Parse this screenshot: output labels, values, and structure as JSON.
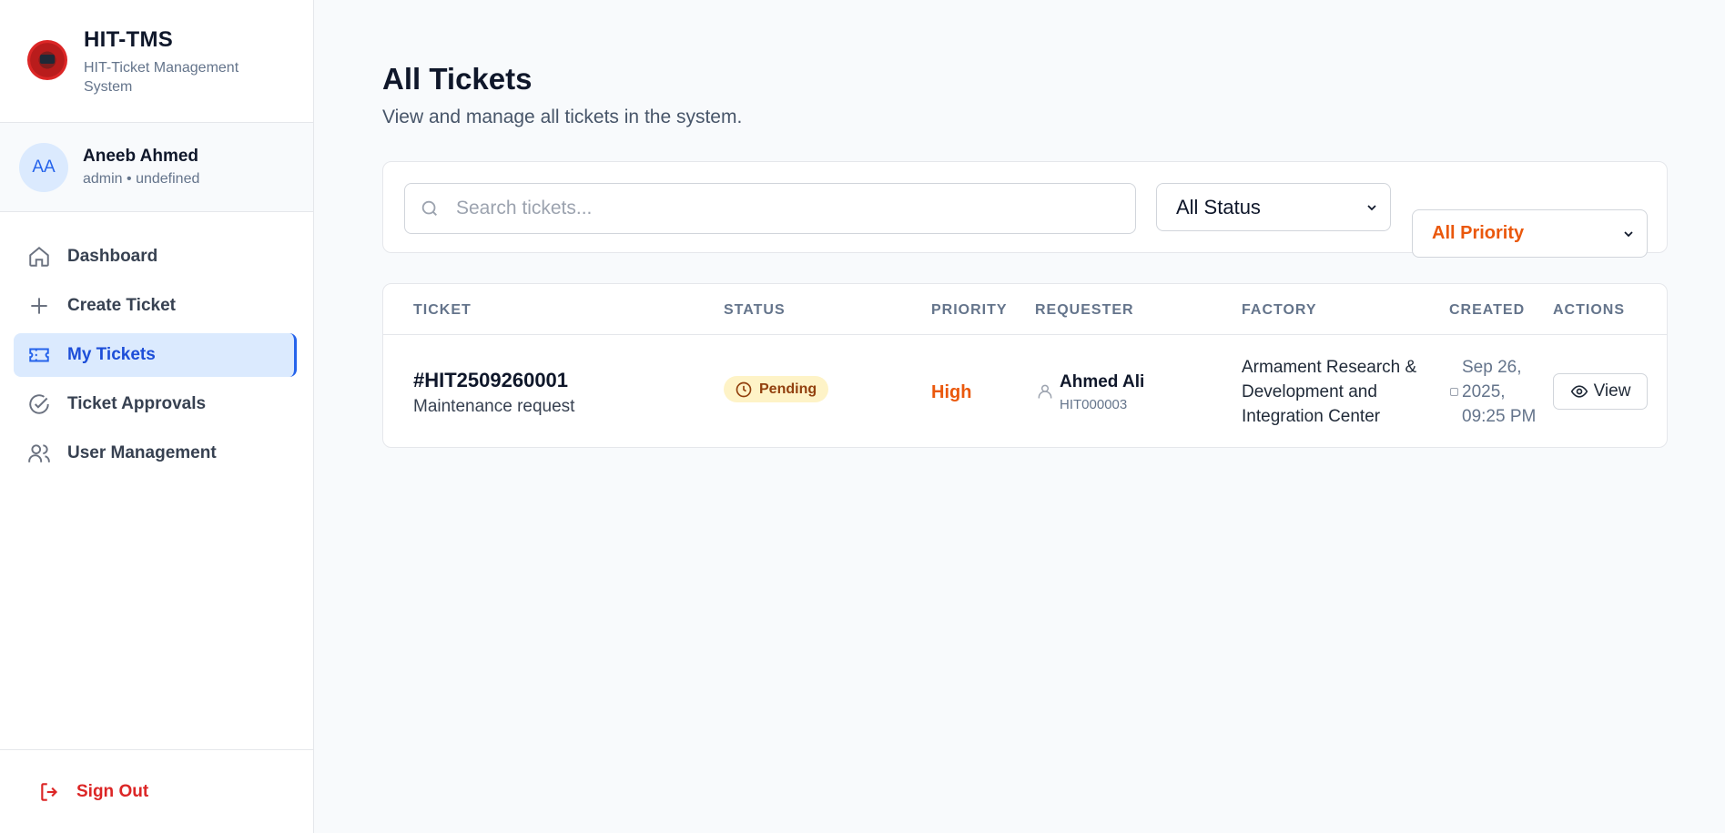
{
  "brand": {
    "title": "HIT-TMS",
    "subtitle": "HIT-Ticket Management System"
  },
  "user": {
    "initials": "AA",
    "name": "Aneeb Ahmed",
    "role": "admin • undefined"
  },
  "nav": {
    "items": [
      {
        "label": "Dashboard",
        "icon": "home-icon",
        "active": false
      },
      {
        "label": "Create Ticket",
        "icon": "plus-icon",
        "active": false
      },
      {
        "label": "My Tickets",
        "icon": "ticket-icon",
        "active": true
      },
      {
        "label": "Ticket Approvals",
        "icon": "check-circle-icon",
        "active": false
      },
      {
        "label": "User Management",
        "icon": "users-icon",
        "active": false
      }
    ],
    "sign_out": "Sign Out"
  },
  "page": {
    "title": "All Tickets",
    "subtitle": "View and manage all tickets in the system."
  },
  "filters": {
    "search_placeholder": "Search tickets...",
    "status_selected": "All Status",
    "priority_selected": "All Priority"
  },
  "table": {
    "headers": {
      "ticket": "TICKET",
      "status": "STATUS",
      "priority": "PRIORITY",
      "requester": "REQUESTER",
      "factory": "FACTORY",
      "created": "CREATED",
      "actions": "ACTIONS"
    },
    "rows": [
      {
        "id": "#HIT2509260001",
        "title": "Maintenance request",
        "status": "Pending",
        "priority": "High",
        "requester_name": "Ahmed Ali",
        "requester_id": "HIT000003",
        "factory": "Armament Research & Development and Integration Center",
        "created": "Sep 26, 2025, 09:25 PM",
        "action": "View"
      }
    ]
  },
  "colors": {
    "accent": "#2563eb",
    "active_bg": "#dbeafe",
    "danger": "#dc2626",
    "priority_high": "#ea580c",
    "pending_bg": "#fef3c7",
    "pending_text": "#92400e"
  }
}
